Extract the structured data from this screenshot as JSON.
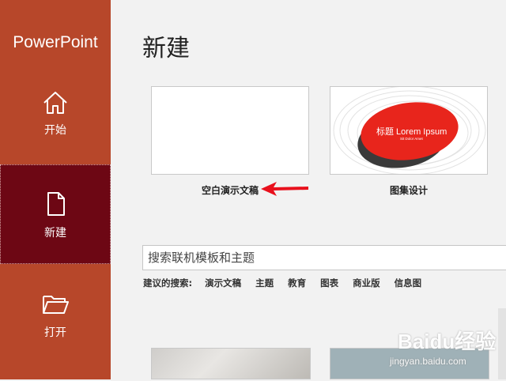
{
  "app": {
    "title": "PowerPoint"
  },
  "sidebar": {
    "items": [
      {
        "label": "开始",
        "icon": "home-icon"
      },
      {
        "label": "新建",
        "icon": "new-file-icon",
        "selected": true
      },
      {
        "label": "打开",
        "icon": "open-folder-icon"
      }
    ]
  },
  "main": {
    "title": "新建",
    "templates": [
      {
        "label": "空白演示文稿"
      },
      {
        "label": "图集设计",
        "preview_title": "标题 Lorem Ipsum",
        "preview_subtitle": "Sit Dolor Amet"
      }
    ],
    "search": {
      "placeholder": "搜索联机模板和主题"
    },
    "suggested": {
      "label": "建议的搜索:",
      "tags": [
        "演示文稿",
        "主题",
        "教育",
        "图表",
        "商业版",
        "信息图"
      ]
    }
  },
  "watermark": {
    "text": "Baidu经验",
    "sub": "jingyan.baidu.com"
  },
  "colors": {
    "sidebar": "#b7472a",
    "selected": "#6d0714",
    "accent_red": "#e8251c",
    "arrow": "#e8101c"
  }
}
